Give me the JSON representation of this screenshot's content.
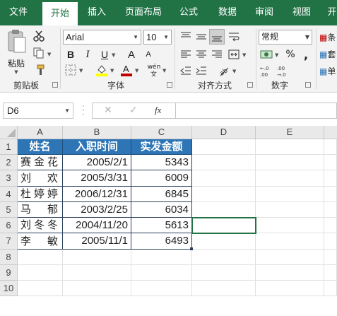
{
  "ribbon_tabs": [
    "文件",
    "开始",
    "插入",
    "页面布局",
    "公式",
    "数据",
    "审阅",
    "视图",
    "开"
  ],
  "active_tab": "开始",
  "clipboard": {
    "paste_label": "粘贴",
    "group_label": "剪贴板"
  },
  "font": {
    "name": "Arial",
    "size": "10",
    "group_label": "字体",
    "bold": "B",
    "italic": "I",
    "underline": "U",
    "grow": "A",
    "shrink": "A",
    "wen": "wén"
  },
  "alignment": {
    "group_label": "对齐方式"
  },
  "number": {
    "format": "常规",
    "group_label": "数字",
    "percent": "%",
    "comma": ","
  },
  "styles": {
    "partial": [
      "条",
      "套",
      "单"
    ]
  },
  "formula_bar": {
    "cell_ref": "D6",
    "fx": "fx",
    "cancel": "✕",
    "enter": "✓",
    "value": ""
  },
  "columns": [
    "A",
    "B",
    "C",
    "D",
    "E"
  ],
  "rows": [
    "1",
    "2",
    "3",
    "4",
    "5",
    "6",
    "7",
    "8",
    "9",
    "10"
  ],
  "table": {
    "headers": [
      "姓名",
      "入职时间",
      "实发金额"
    ],
    "rows": [
      [
        "赛金花",
        "2005/2/1",
        "5343"
      ],
      [
        "刘欢",
        "2005/3/31",
        "6009"
      ],
      [
        "杜婷婷",
        "2006/12/31",
        "6845"
      ],
      [
        "马郁",
        "2003/2/25",
        "6034"
      ],
      [
        "刘冬冬",
        "2004/11/20",
        "5613"
      ],
      [
        "李敏",
        "2005/11/1",
        "6493"
      ]
    ]
  },
  "colors": {
    "ribbon_green": "#217346",
    "header_fill": "#2e75b6"
  }
}
